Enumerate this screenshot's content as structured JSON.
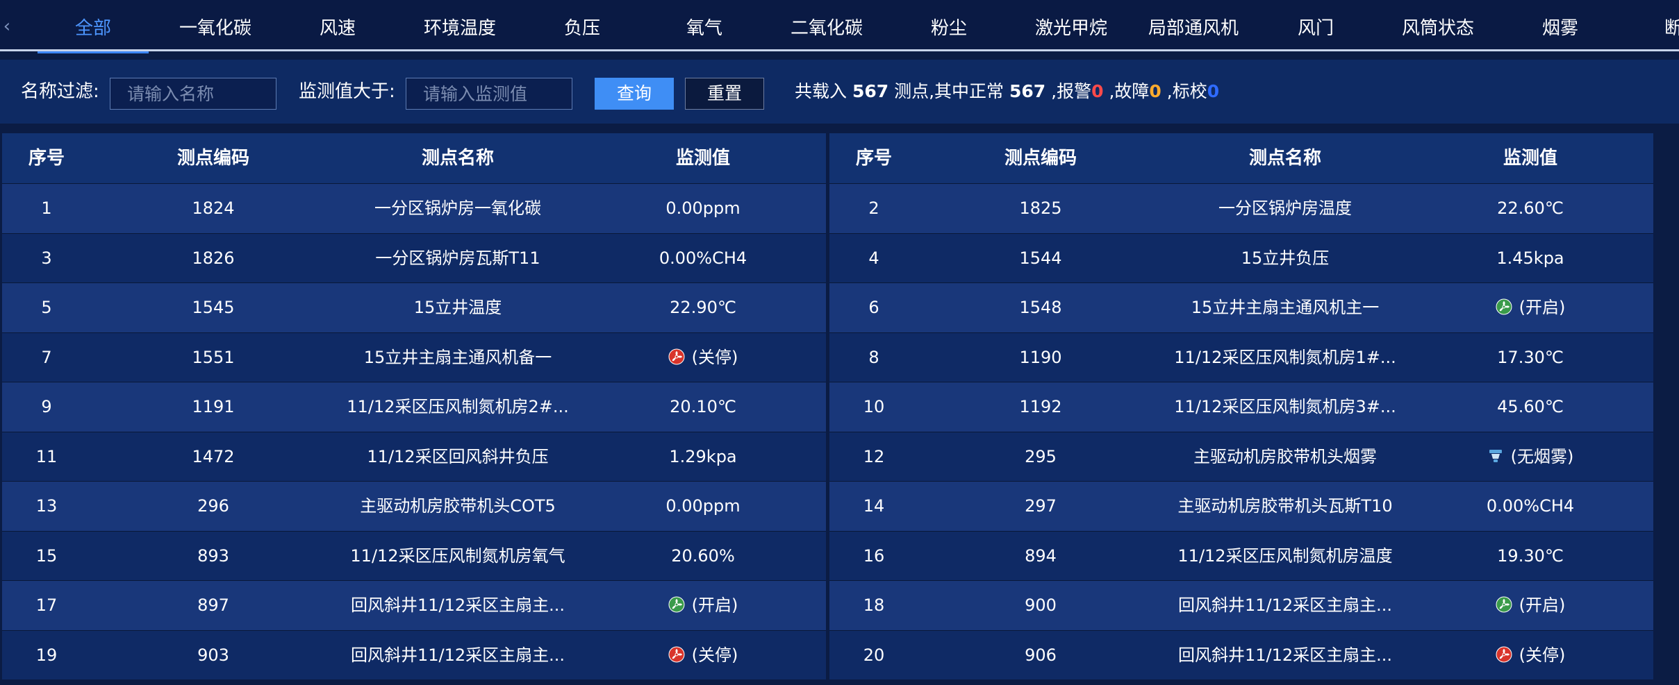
{
  "tabs": {
    "arrow": "‹",
    "items": [
      "全部",
      "一氧化碳",
      "风速",
      "环境温度",
      "负压",
      "氧气",
      "二氧化碳",
      "粉尘",
      "激光甲烷",
      "局部通风机",
      "风门",
      "风筒状态",
      "烟雾",
      "断电"
    ],
    "active_index": 0
  },
  "filter": {
    "name_label": "名称过滤:",
    "name_placeholder": "请输入名称",
    "value_label": "监测值大于:",
    "value_placeholder": "请输入监测值",
    "query_label": "查询",
    "reset_label": "重置"
  },
  "summary": {
    "prefix": "共载入",
    "total": "567",
    "unit_text": "测点,其中正常",
    "normal": "567",
    "alarm_label": ",报警",
    "alarm": "0",
    "fault_label": ",故障",
    "fault": "0",
    "calib_label": ",标校",
    "calib": "0"
  },
  "colors": {
    "accent": "#3f8ef5",
    "alarm": "#ff4a4a",
    "fault": "#ffab2e",
    "calib": "#2f6bff",
    "fan_on": "#3a9b4a",
    "fan_off": "#d9342b",
    "smoke": "#5aa7e0"
  },
  "table": {
    "headers": [
      "序号",
      "测点编码",
      "测点名称",
      "监测值"
    ],
    "left_rows": [
      {
        "no": "1",
        "code": "1824",
        "name": "一分区锅炉房一氧化碳",
        "value": "0.00ppm",
        "icon": ""
      },
      {
        "no": "3",
        "code": "1826",
        "name": "一分区锅炉房瓦斯T11",
        "value": "0.00%CH4",
        "icon": ""
      },
      {
        "no": "5",
        "code": "1545",
        "name": "15立井温度",
        "value": "22.90℃",
        "icon": ""
      },
      {
        "no": "7",
        "code": "1551",
        "name": "15立井主扇主通风机备一",
        "value": "(关停)",
        "icon": "fan-off-icon"
      },
      {
        "no": "9",
        "code": "1191",
        "name": "11/12采区压风制氮机房2#...",
        "value": "20.10℃",
        "icon": ""
      },
      {
        "no": "11",
        "code": "1472",
        "name": "11/12采区回风斜井负压",
        "value": "1.29kpa",
        "icon": ""
      },
      {
        "no": "13",
        "code": "296",
        "name": "主驱动机房胶带机头COT5",
        "value": "0.00ppm",
        "icon": ""
      },
      {
        "no": "15",
        "code": "893",
        "name": "11/12采区压风制氮机房氧气",
        "value": "20.60%",
        "icon": ""
      },
      {
        "no": "17",
        "code": "897",
        "name": "回风斜井11/12采区主扇主...",
        "value": "(开启)",
        "icon": "fan-on-icon"
      },
      {
        "no": "19",
        "code": "903",
        "name": "回风斜井11/12采区主扇主...",
        "value": "(关停)",
        "icon": "fan-off-icon"
      }
    ],
    "right_rows": [
      {
        "no": "2",
        "code": "1825",
        "name": "一分区锅炉房温度",
        "value": "22.60℃",
        "icon": ""
      },
      {
        "no": "4",
        "code": "1544",
        "name": "15立井负压",
        "value": "1.45kpa",
        "icon": ""
      },
      {
        "no": "6",
        "code": "1548",
        "name": "15立井主扇主通风机主一",
        "value": "(开启)",
        "icon": "fan-on-icon"
      },
      {
        "no": "8",
        "code": "1190",
        "name": "11/12采区压风制氮机房1#...",
        "value": "17.30℃",
        "icon": ""
      },
      {
        "no": "10",
        "code": "1192",
        "name": "11/12采区压风制氮机房3#...",
        "value": "45.60℃",
        "icon": ""
      },
      {
        "no": "12",
        "code": "295",
        "name": "主驱动机房胶带机头烟雾",
        "value": "(无烟雾)",
        "icon": "smoke-detector-icon"
      },
      {
        "no": "14",
        "code": "297",
        "name": "主驱动机房胶带机头瓦斯T10",
        "value": "0.00%CH4",
        "icon": ""
      },
      {
        "no": "16",
        "code": "894",
        "name": "11/12采区压风制氮机房温度",
        "value": "19.30℃",
        "icon": ""
      },
      {
        "no": "18",
        "code": "900",
        "name": "回风斜井11/12采区主扇主...",
        "value": "(开启)",
        "icon": "fan-on-icon"
      },
      {
        "no": "20",
        "code": "906",
        "name": "回风斜井11/12采区主扇主...",
        "value": "(关停)",
        "icon": "fan-off-icon"
      }
    ]
  }
}
